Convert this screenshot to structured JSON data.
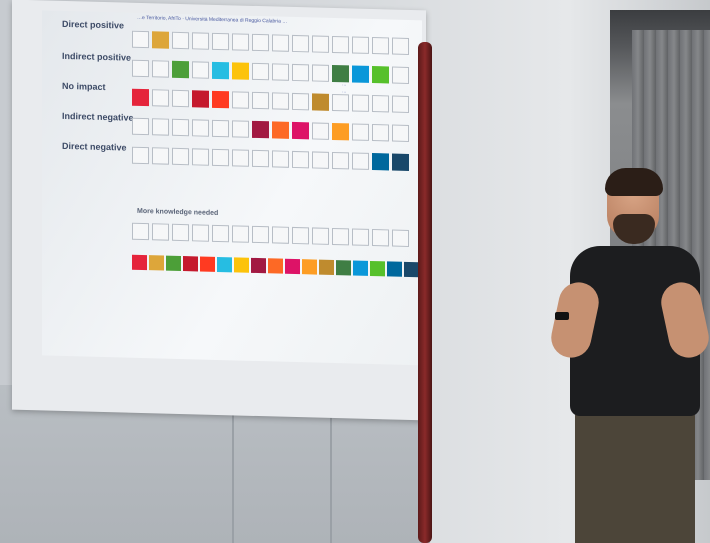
{
  "slide": {
    "header_text": "…e Territorio, AfriTo · Università Mediterranea di Reggio Calabria …",
    "row_labels": [
      "Direct positive",
      "Indirect positive",
      "No impact",
      "Indirect negative",
      "Direct negative"
    ],
    "section_title": "More knowledge needed",
    "legend": [
      "…",
      "…",
      "…"
    ]
  },
  "colors": {
    "sdg": [
      "#e5243b",
      "#dda63a",
      "#4c9f38",
      "#c5192d",
      "#ff3a21",
      "#26bde2",
      "#fcc30b",
      "#a21942",
      "#fd6925",
      "#dd1367",
      "#fd9d24",
      "#bf8b2e",
      "#3f7e44",
      "#0a97d9",
      "#56c02b",
      "#00689d",
      "#19486a"
    ]
  }
}
